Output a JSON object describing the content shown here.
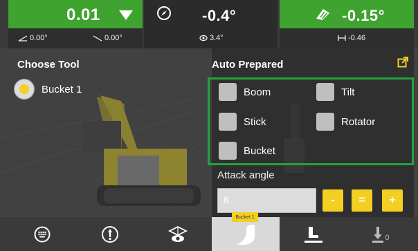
{
  "colors": {
    "accent_green": "#3fa32f",
    "highlight_green": "#22a33a",
    "accent_yellow": "#f3cf21",
    "panel_dark": "#2d2d2d"
  },
  "topbar": {
    "left": {
      "value": "0.01",
      "sub1_icon": "cross-slope-icon",
      "sub1": "0.00°",
      "sub2_icon": "slope-icon",
      "sub2": "0.00°",
      "dropdown_icon": "triangle-down-icon"
    },
    "middle": {
      "icon": "compass-icon",
      "value": "-0.4°",
      "sub_icon": "rotate-icon",
      "sub": "3.4°"
    },
    "right": {
      "icon": "bucket-angle-icon",
      "value": "-0.15°",
      "sub_icon": "width-icon",
      "sub": "-0.46"
    }
  },
  "left_panel": {
    "title": "Choose Tool",
    "tools": [
      {
        "label": "Bucket 1",
        "selected": true
      }
    ]
  },
  "right_panel": {
    "title": "Auto Prepared",
    "external_icon": "external-link-icon",
    "checkboxes": [
      {
        "label": "Boom",
        "checked": false
      },
      {
        "label": "Tilt",
        "checked": false
      },
      {
        "label": "Stick",
        "checked": false
      },
      {
        "label": "Rotator",
        "checked": false
      },
      {
        "label": "Bucket",
        "checked": false
      }
    ],
    "attack_label": "Attack angle",
    "attack_value": "8",
    "buttons": {
      "minus": "-",
      "equals": "=",
      "plus": "+"
    }
  },
  "bottombar": {
    "items": [
      {
        "icon": "keypad-icon"
      },
      {
        "icon": "position-marker-icon"
      },
      {
        "icon": "view-icon"
      },
      {
        "icon": "bucket-icon",
        "active": true,
        "tooltip": "Bucket 1"
      },
      {
        "icon": "bucket-ground-icon"
      },
      {
        "icon": "offset-zero-icon",
        "sub": "0"
      }
    ]
  }
}
